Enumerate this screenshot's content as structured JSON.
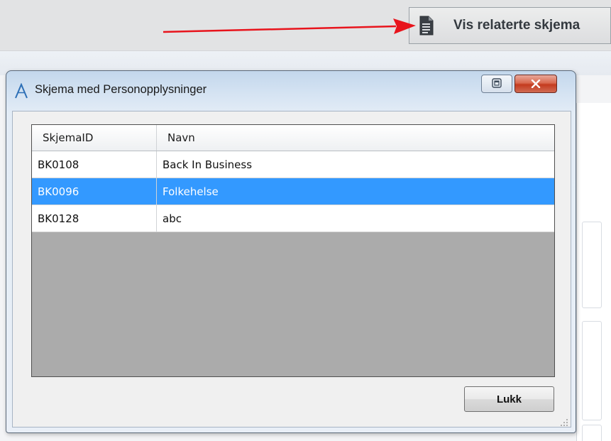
{
  "toolbar": {
    "related_button_label": "Vis relaterte skjema",
    "related_button_icon": "document-icon"
  },
  "annotation": {
    "arrow_color": "#e8141c"
  },
  "dialog": {
    "title": "Skjema med Personopplysninger",
    "app_icon": "app-logo-a-icon",
    "restore_icon": "restore-icon",
    "close_icon": "close-icon",
    "columns": [
      "SkjemaID",
      "Navn"
    ],
    "rows": [
      {
        "id": "BK0108",
        "name": "Back In Business",
        "selected": false
      },
      {
        "id": "BK0096",
        "name": "Folkehelse",
        "selected": true
      },
      {
        "id": "BK0128",
        "name": "abc",
        "selected": false
      }
    ],
    "close_button_label": "Lukk",
    "selection_color": "#3399ff"
  }
}
